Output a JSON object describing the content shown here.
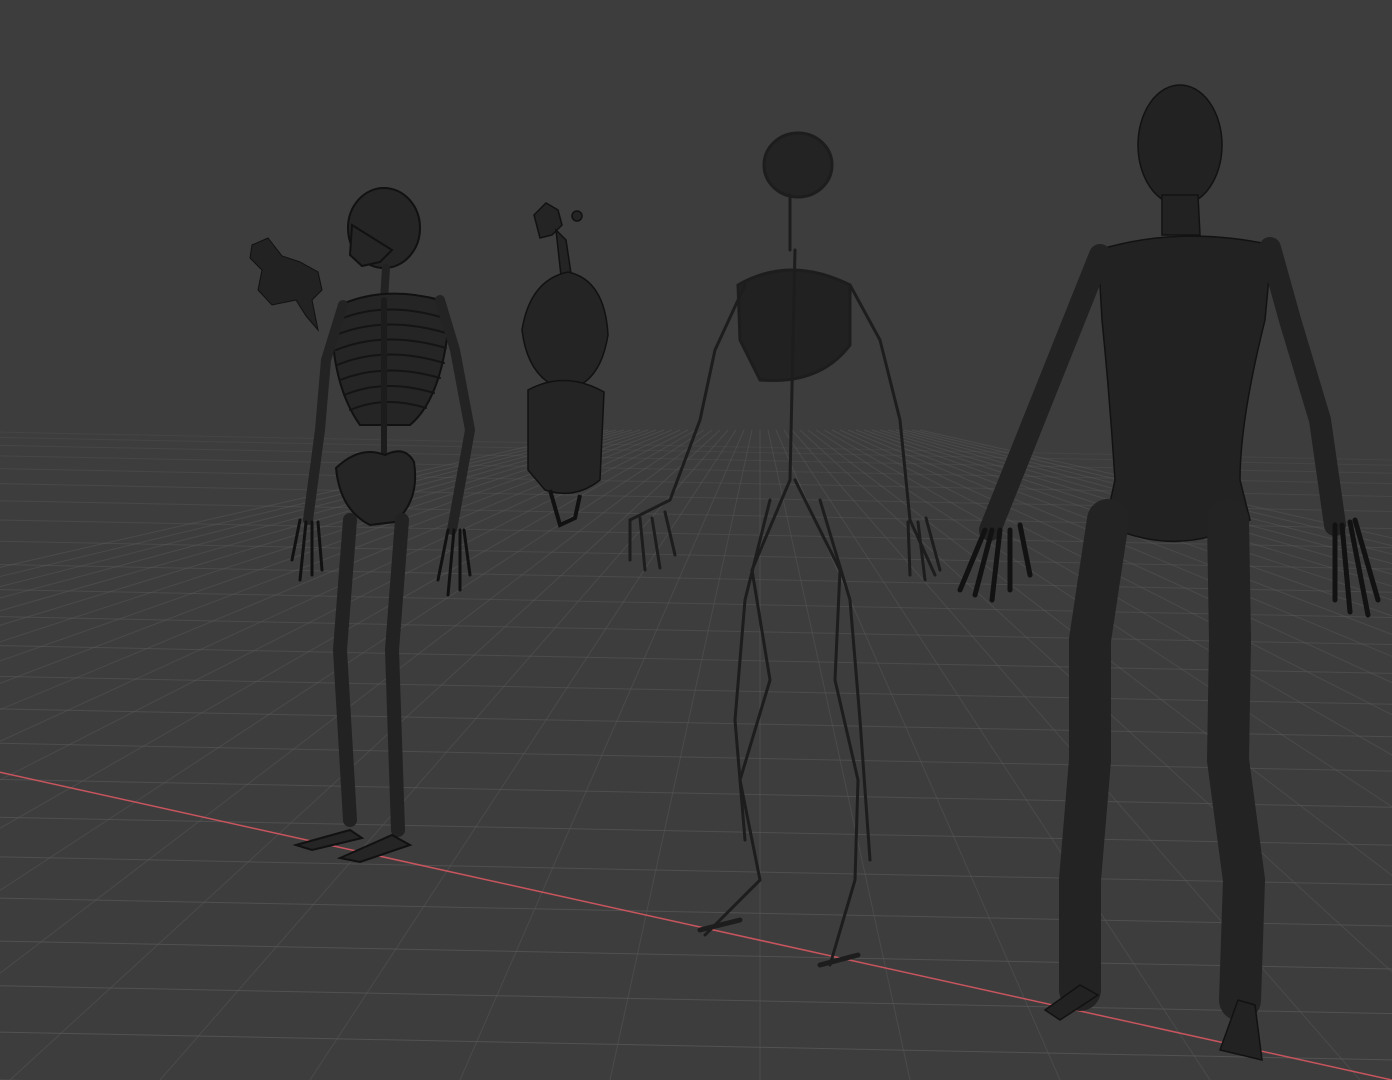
{
  "viewport": {
    "view": "perspective",
    "shading": "wireframe"
  },
  "scene": {
    "grid": true,
    "x_axis_color": "#c8555e",
    "background_color": "#3d3d3d",
    "mesh_color": "#1f1f1f",
    "objects": [
      {
        "label": "skeleton"
      },
      {
        "label": "skull"
      },
      {
        "label": "organs"
      },
      {
        "label": "circulatory-system"
      },
      {
        "label": "muscle-body"
      }
    ]
  }
}
